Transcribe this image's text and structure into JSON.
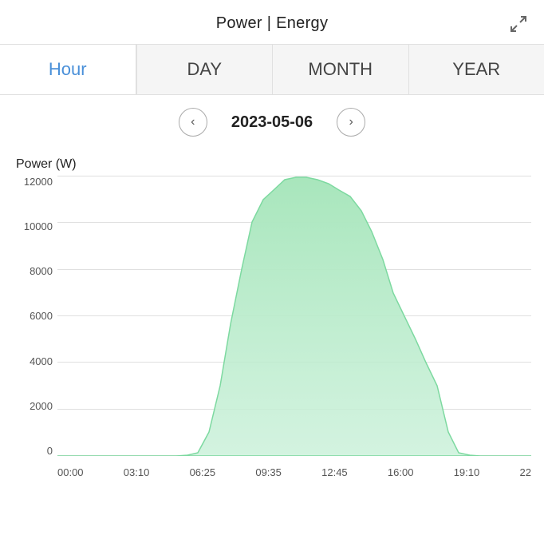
{
  "header": {
    "title": "Power | Energy"
  },
  "tabs": [
    {
      "id": "hour",
      "label": "Hour",
      "active": true
    },
    {
      "id": "day",
      "label": "DAY",
      "active": false
    },
    {
      "id": "month",
      "label": "MONTH",
      "active": false
    },
    {
      "id": "year",
      "label": "YEAR",
      "active": false
    }
  ],
  "date_nav": {
    "prev_label": "‹",
    "next_label": "›",
    "current_date": "2023-05-06"
  },
  "chart": {
    "y_label": "Power (W)",
    "y_ticks": [
      "0",
      "2000",
      "4000",
      "6000",
      "8000",
      "10000",
      "12000"
    ],
    "x_ticks": [
      "00:00",
      "03:10",
      "06:25",
      "09:35",
      "12:45",
      "16:00",
      "19:10",
      "22"
    ],
    "fill_color": "#a8e6bc",
    "stroke_color": "#6dcc8e"
  }
}
